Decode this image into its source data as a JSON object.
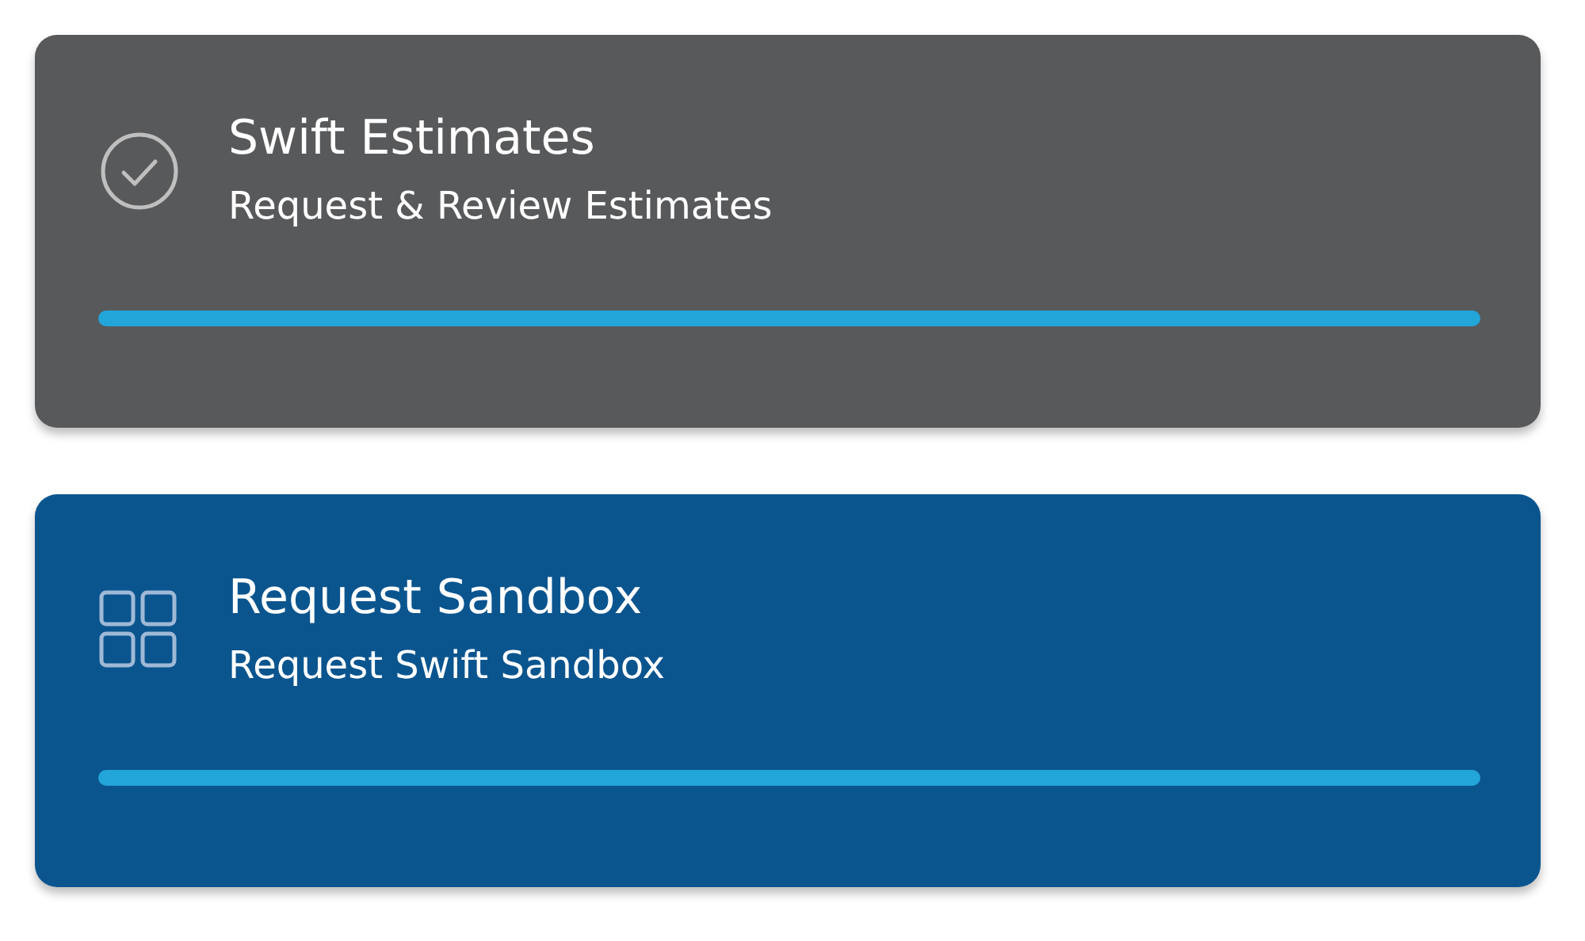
{
  "cards": [
    {
      "kind": "check",
      "title": "Swift Estimates",
      "subtitle": "Request & Review Estimates",
      "selected": false
    },
    {
      "kind": "grid",
      "title": "Request Sandbox",
      "subtitle": "Request Swift Sandbox",
      "selected": true
    }
  ]
}
